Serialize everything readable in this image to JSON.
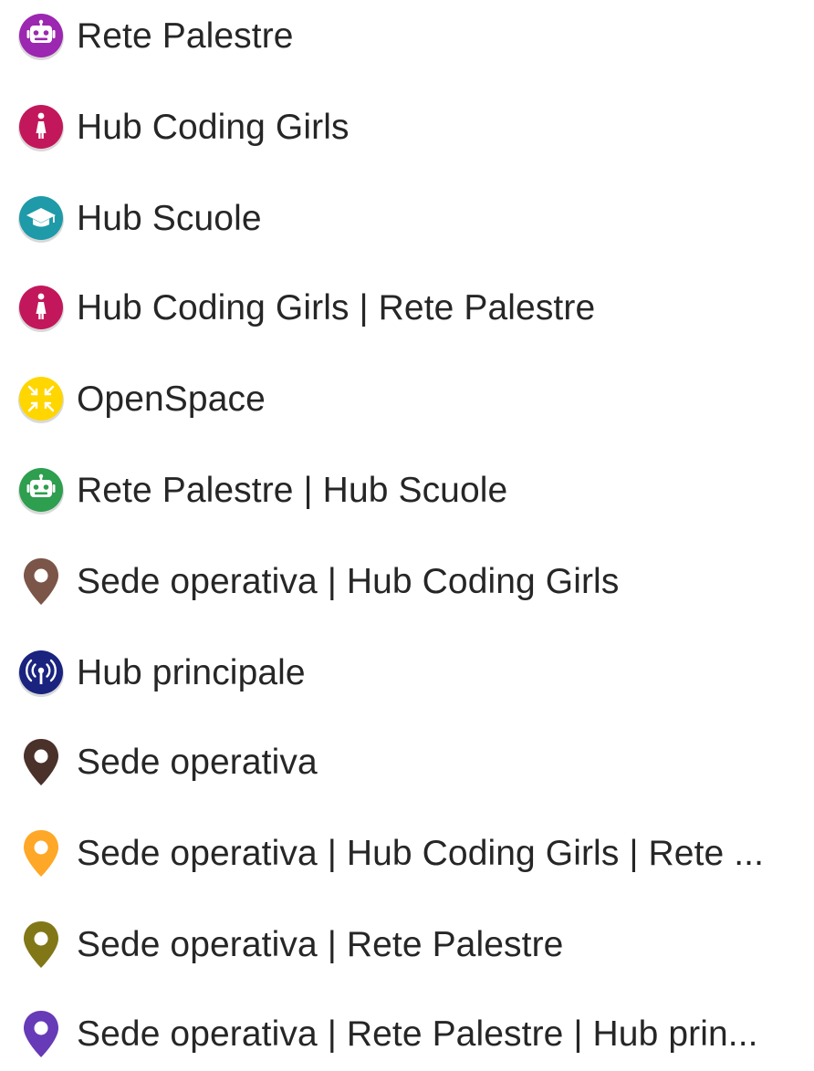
{
  "legend": {
    "items": [
      {
        "label": "Rete Palestre",
        "icon": "robot-icon",
        "shape": "circle",
        "color": "#9c27b0"
      },
      {
        "label": "Hub Coding Girls",
        "icon": "girl-icon",
        "shape": "circle",
        "color": "#c2185b"
      },
      {
        "label": "Hub Scuole",
        "icon": "graduation-cap-icon",
        "shape": "circle",
        "color": "#1e9aa8"
      },
      {
        "label": "Hub Coding Girls | Rete Palestre",
        "icon": "girl-icon",
        "shape": "circle",
        "color": "#c2185b"
      },
      {
        "label": "OpenSpace",
        "icon": "compress-arrows-icon",
        "shape": "circle",
        "color": "#ffd600"
      },
      {
        "label": "Rete Palestre | Hub Scuole",
        "icon": "robot-icon",
        "shape": "circle",
        "color": "#2e9e4f"
      },
      {
        "label": "Sede operativa | Hub Coding Girls",
        "icon": "map-pin-icon",
        "shape": "pin",
        "color": "#7b5548"
      },
      {
        "label": "Hub principale",
        "icon": "broadcast-antenna-icon",
        "shape": "circle",
        "color": "#1a237e"
      },
      {
        "label": "Sede operativa",
        "icon": "map-pin-icon",
        "shape": "pin",
        "color": "#4a3129"
      },
      {
        "label": "Sede operativa | Hub Coding Girls | Rete ...",
        "icon": "map-pin-icon",
        "shape": "pin",
        "color": "#ffa726"
      },
      {
        "label": "Sede operativa | Rete Palestre",
        "icon": "map-pin-icon",
        "shape": "pin",
        "color": "#827717"
      },
      {
        "label": "Sede operativa | Rete Palestre | Hub prin...",
        "icon": "map-pin-icon",
        "shape": "pin",
        "color": "#673ab7"
      }
    ]
  }
}
